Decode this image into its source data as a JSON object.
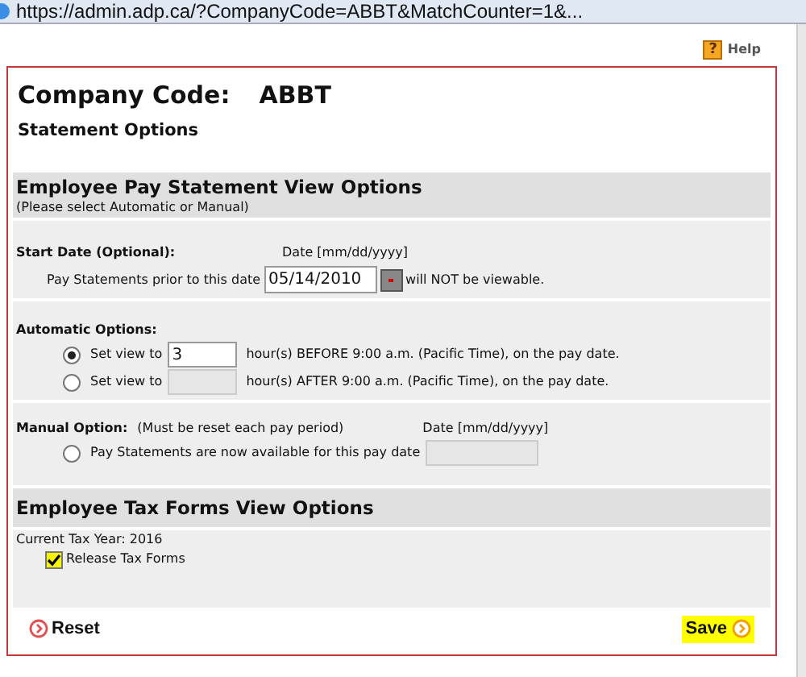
{
  "window": {
    "title": "https://admin.adp.ca/?CompanyCode=ABBT&MatchCounter=1&..."
  },
  "help": {
    "icon": "?",
    "label": "Help"
  },
  "company": {
    "label": "Company Code:",
    "value": "ABBT"
  },
  "page_title": "Statement Options",
  "pay_section": {
    "title": "Employee Pay Statement View Options",
    "subtitle": "(Please select Automatic or Manual)",
    "start_date": {
      "label": "Start Date (Optional):",
      "format": "Date [mm/dd/yyyy]",
      "before": "Pay Statements prior to this date",
      "value": "05/14/2010",
      "after": "will NOT be viewable."
    },
    "automatic": {
      "label": "Automatic Options:",
      "options": [
        {
          "prefix": "Set view to",
          "value": "3",
          "suffix": "hour(s) BEFORE 9:00 a.m. (Pacific Time),  on the pay date.",
          "selected": true,
          "disabled": false
        },
        {
          "prefix": "Set view to",
          "suffix": "hour(s) AFTER 9:00 a.m. (Pacific Time),  on the pay date.",
          "selected": false,
          "disabled": true
        }
      ]
    },
    "manual": {
      "label": "Manual Option:",
      "note": "(Must be reset each pay period)",
      "format": "Date [mm/dd/yyyy]",
      "option": {
        "text": "Pay Statements are now available for this pay date",
        "selected": false,
        "disabled": true
      }
    }
  },
  "tax_section": {
    "title": "Employee Tax Forms View Options",
    "year_label": "Current Tax Year:  2016",
    "release": {
      "label": "Release Tax Forms",
      "checked": true
    }
  },
  "buttons": {
    "reset": "Reset",
    "save": "Save"
  }
}
